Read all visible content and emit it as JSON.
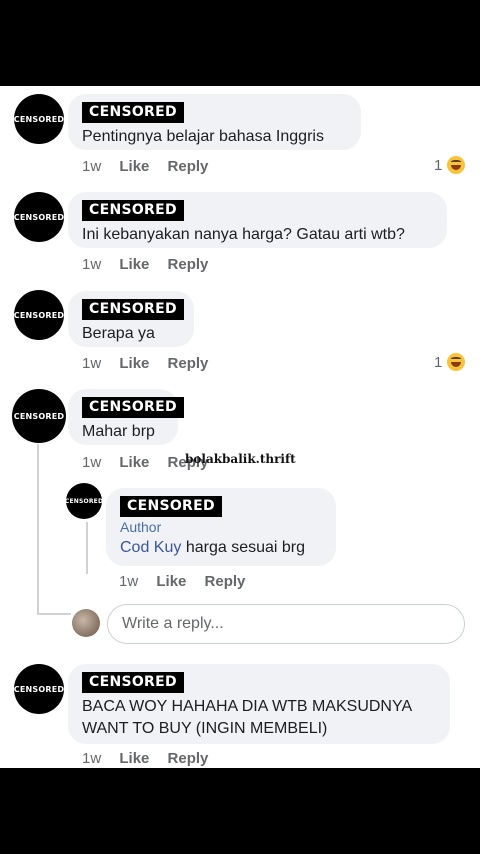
{
  "avatar_label": "CENSORED",
  "actions": {
    "time": "1w",
    "like": "Like",
    "reply": "Reply"
  },
  "comments": [
    {
      "name": "CENSORED",
      "text": "Pentingnya belajar bahasa Inggris",
      "reactions": "1"
    },
    {
      "name": "CENSORED",
      "text": "Ini kebanyakan nanya harga? Gatau arti wtb?"
    },
    {
      "name": "CENSORED",
      "text": "Berapa ya",
      "reactions": "1"
    },
    {
      "name": "CENSORED",
      "text": "Mahar brp"
    },
    {
      "name": "CENSORED",
      "author_badge": "Author",
      "mention": "Cod Kuy",
      "text": " harga sesuai brg"
    },
    {
      "name": "CENSORED",
      "text_line1": "BACA WOY HAHAHA DIA WTB MAKSUDNYA",
      "text_line2": "WANT TO BUY (INGIN MEMBELI)"
    }
  ],
  "watermark": "bolakbalik.thrift",
  "reply_input": {
    "placeholder": "Write a reply..."
  },
  "reaction_icon": "laughing-emoji-icon"
}
